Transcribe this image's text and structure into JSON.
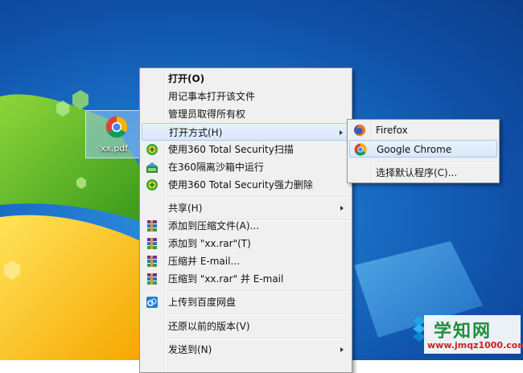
{
  "desktop": {
    "file": {
      "name": "xx.pdf",
      "icon": "chrome-icon"
    }
  },
  "context_menu": {
    "items": [
      {
        "label": "打开(O)",
        "icon": ""
      },
      {
        "label": "用记事本打开该文件",
        "icon": ""
      },
      {
        "label": "管理员取得所有权",
        "icon": ""
      },
      {
        "label": "打开方式(H)",
        "icon": "",
        "submenu": true
      },
      {
        "label": "使用360 Total Security扫描",
        "icon": "360-icon"
      },
      {
        "label": "在360隔离沙箱中运行",
        "icon": "sandbox-icon"
      },
      {
        "label": "使用360 Total Security强力删除",
        "icon": "360-icon"
      },
      {
        "label": "共享(H)",
        "icon": "",
        "submenu": true
      },
      {
        "label": "添加到压缩文件(A)...",
        "icon": "winrar-icon"
      },
      {
        "label": "添加到 \"xx.rar\"(T)",
        "icon": "winrar-icon"
      },
      {
        "label": "压缩并 E-mail...",
        "icon": "winrar-icon"
      },
      {
        "label": "压缩到 \"xx.rar\" 并 E-mail",
        "icon": "winrar-icon"
      },
      {
        "label": "上传到百度网盘",
        "icon": "baidu-netdisk-icon"
      },
      {
        "label": "还原以前的版本(V)",
        "icon": ""
      },
      {
        "label": "发送到(N)",
        "icon": "",
        "submenu": true
      }
    ]
  },
  "open_with_submenu": {
    "items": [
      {
        "label": "Firefox",
        "icon": "firefox-icon"
      },
      {
        "label": "Google Chrome",
        "icon": "chrome-icon"
      },
      {
        "label": "选择默认程序(C)...",
        "icon": ""
      }
    ]
  },
  "watermark": {
    "title": "学知网",
    "url": "www.jmqz1000.com"
  },
  "colors": {
    "desktop_blue": "#1a6fc7",
    "menu_bg": "#f0f0f0",
    "highlight": "#d8e7fa"
  }
}
